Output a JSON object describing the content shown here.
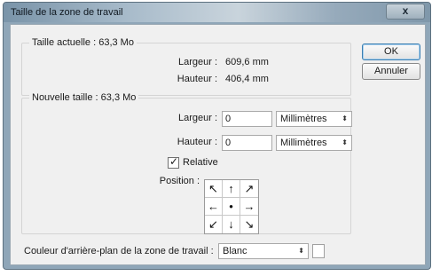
{
  "window": {
    "title": "Taille de la zone de travail",
    "close_glyph": "x"
  },
  "current_size": {
    "title": "Taille actuelle : 63,3 Mo",
    "width_label": "Largeur :",
    "width_value": "609,6 mm",
    "height_label": "Hauteur :",
    "height_value": "406,4 mm"
  },
  "new_size": {
    "title": "Nouvelle taille : 63,3 Mo",
    "width_label": "Largeur :",
    "width_value": "0",
    "width_unit": "Millimètres",
    "height_label": "Hauteur :",
    "height_value": "0",
    "height_unit": "Millimètres",
    "relative_label": "Relative",
    "relative_checked": true,
    "position_label": "Position :",
    "anchor_arrows": [
      "↖",
      "↑",
      "↗",
      "←",
      "•",
      "→",
      "↙",
      "↓",
      "↘"
    ]
  },
  "buttons": {
    "ok": "OK",
    "cancel": "Annuler"
  },
  "background": {
    "label": "Couleur d'arrière-plan de la zone de travail :",
    "value": "Blanc",
    "swatch_color": "#ffffff"
  },
  "icons": {
    "close": "close-icon",
    "dropdown": "chevron-updown-icon",
    "check": "check-icon"
  }
}
